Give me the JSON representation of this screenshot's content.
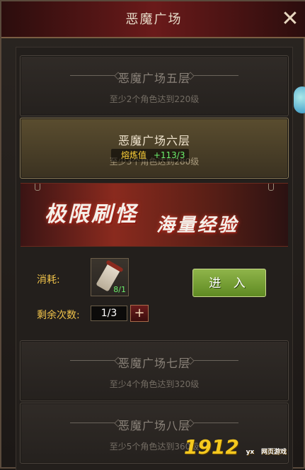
{
  "window": {
    "title": "恶魔广场",
    "close_icon": "close-icon"
  },
  "levels": [
    {
      "name": "恶魔广场五层",
      "requirement": "至少2个角色达到220级",
      "state": "disabled"
    },
    {
      "name": "恶魔广场六层",
      "requirement": "至少3个角色达到280级",
      "state": "selected"
    },
    {
      "name": "恶魔广场七层",
      "requirement": "至少4个角色达到320级",
      "state": "disabled"
    },
    {
      "name": "恶魔广场八层",
      "requirement": "至少5个角色达到360级",
      "state": "disabled"
    }
  ],
  "tooltip": {
    "label": "熔炼值",
    "value": "+113/3"
  },
  "banner": {
    "left_text": "极限刷怪",
    "right_text": "海量经验"
  },
  "consume": {
    "label": "消耗:",
    "item_icon": "scroll-icon",
    "item_count": "8/1"
  },
  "remaining": {
    "label": "剩余次数:",
    "value": "1/3",
    "plus_icon": "plus-icon"
  },
  "enter_button": {
    "label": "进 入"
  },
  "watermark": {
    "text": "1912",
    "badge": "yx",
    "subtext": "网页游戏"
  },
  "colors": {
    "accent_gold": "#f0c34a",
    "enter_green": "#6f9a2f",
    "title_red": "#6a1a1a"
  }
}
